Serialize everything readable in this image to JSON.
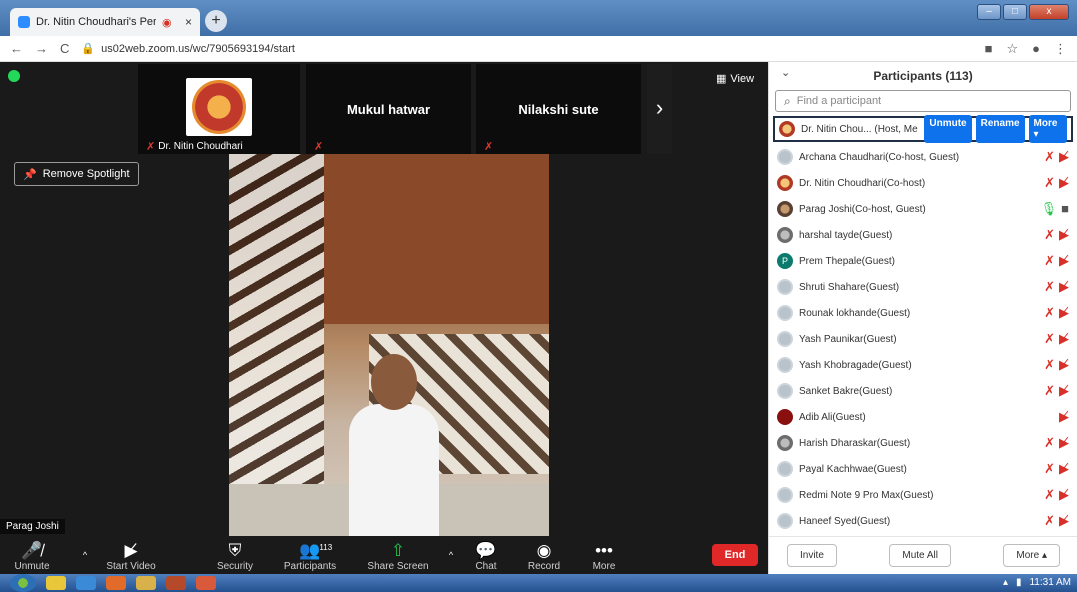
{
  "browser": {
    "tab_title": "Dr. Nitin Choudhari's Person",
    "tab_recording": "◉",
    "tab_close": "×",
    "new_tab": "+",
    "url": "us02web.zoom.us/wc/7905693194/start"
  },
  "meeting": {
    "view_label": "View",
    "remove_spotlight_label": "Remove Spotlight",
    "thumbnails": [
      {
        "name": "",
        "label": "Dr. Nitin Choudhari"
      },
      {
        "name": "Mukul hatwar",
        "label": ""
      },
      {
        "name": "Nilakshi sute",
        "label": ""
      }
    ],
    "next_arrow": "›",
    "active_speaker": "Parag Joshi"
  },
  "toolbar": {
    "unmute": "Unmute",
    "start_video": "Start Video",
    "security": "Security",
    "participants": "Participants",
    "participants_count": "113",
    "share_screen": "Share Screen",
    "chat": "Chat",
    "record": "Record",
    "more": "More",
    "end": "End"
  },
  "panel": {
    "title": "Participants (113)",
    "search_placeholder": "Find a participant",
    "me": {
      "name": "Dr. Nitin Chou... (Host, Me)",
      "unmute": "Unmute",
      "rename": "Rename",
      "more": "More ▾"
    },
    "participants": [
      {
        "name": "Archana Chaudhari(Co-host, Guest)",
        "avatar": "default",
        "mic": "off",
        "cam": "off"
      },
      {
        "name": "Dr. Nitin Choudhari(Co-host)",
        "avatar": "logo",
        "mic": "off",
        "cam": "off"
      },
      {
        "name": "Parag Joshi(Co-host, Guest)",
        "avatar": "photo",
        "mic": "on",
        "cam": "on"
      },
      {
        "name": "harshal tayde(Guest)",
        "avatar": "pic",
        "mic": "off",
        "cam": "off"
      },
      {
        "name": "Prem Thepale(Guest)",
        "avatar": "letter",
        "letter": "P",
        "mic": "off",
        "cam": "off"
      },
      {
        "name": "Shruti Shahare(Guest)",
        "avatar": "default",
        "mic": "off",
        "cam": "off"
      },
      {
        "name": "Rounak lokhande(Guest)",
        "avatar": "default",
        "mic": "off",
        "cam": "off"
      },
      {
        "name": "Yash Paunikar(Guest)",
        "avatar": "default",
        "mic": "off",
        "cam": "off"
      },
      {
        "name": "Yash Khobragade(Guest)",
        "avatar": "default",
        "mic": "off",
        "cam": "off"
      },
      {
        "name": "Sanket Bakre(Guest)",
        "avatar": "default",
        "mic": "off",
        "cam": "off"
      },
      {
        "name": "Adib Ali(Guest)",
        "avatar": "red",
        "mic": "none",
        "cam": "off"
      },
      {
        "name": "Harish Dharaskar(Guest)",
        "avatar": "pic",
        "mic": "off",
        "cam": "off"
      },
      {
        "name": "Payal Kachhwae(Guest)",
        "avatar": "default",
        "mic": "off",
        "cam": "off"
      },
      {
        "name": "Redmi Note 9 Pro Max(Guest)",
        "avatar": "default",
        "mic": "off",
        "cam": "off"
      },
      {
        "name": "Haneef Syed(Guest)",
        "avatar": "default",
        "mic": "off",
        "cam": "off"
      }
    ],
    "invite": "Invite",
    "mute_all": "Mute All",
    "more": "More ▴"
  },
  "taskbar": {
    "clock": "11:31 AM"
  }
}
